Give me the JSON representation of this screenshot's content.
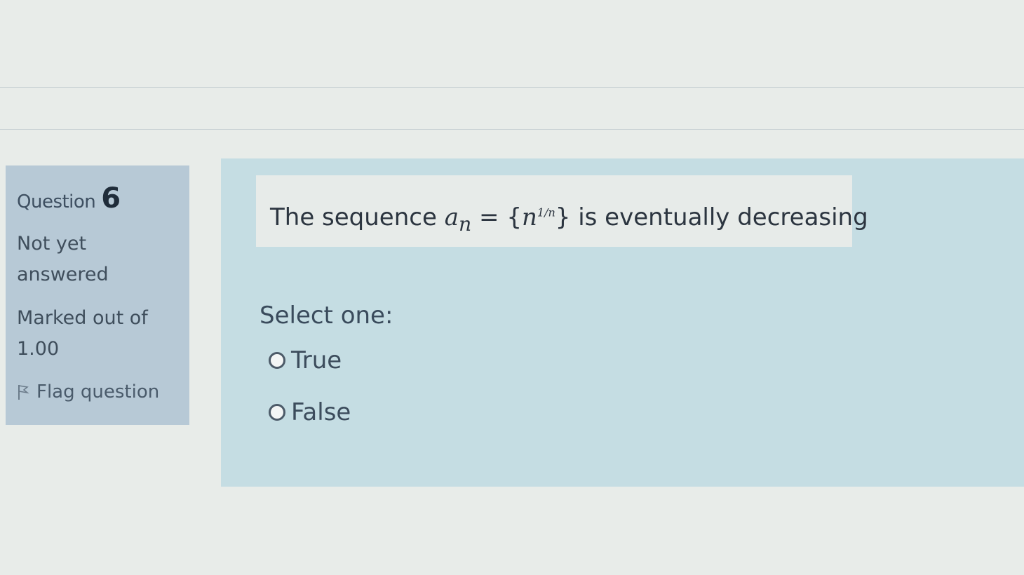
{
  "question": {
    "label": "Question",
    "number": "6",
    "state_line1": "Not yet",
    "state_line2": "answered",
    "grade_line1": "Marked out of",
    "grade_line2": "1.00",
    "flag_label": "Flag question",
    "flag_icon": "flag-icon"
  },
  "question_text": {
    "prefix": "The sequence ",
    "variable": "a",
    "subscript": "n",
    "equals": " = {",
    "base": "n",
    "exponent": "1/n",
    "closing": "}",
    "suffix": " is eventually decreasing"
  },
  "answer": {
    "prompt": "Select one:",
    "options": [
      {
        "label": "True",
        "selected": false
      },
      {
        "label": "False",
        "selected": false
      }
    ]
  },
  "colors": {
    "info_panel": "#b7c9d6",
    "content_panel": "#c5dde3",
    "question_box": "#e7ebe9",
    "page_bg": "#e8ece9"
  }
}
